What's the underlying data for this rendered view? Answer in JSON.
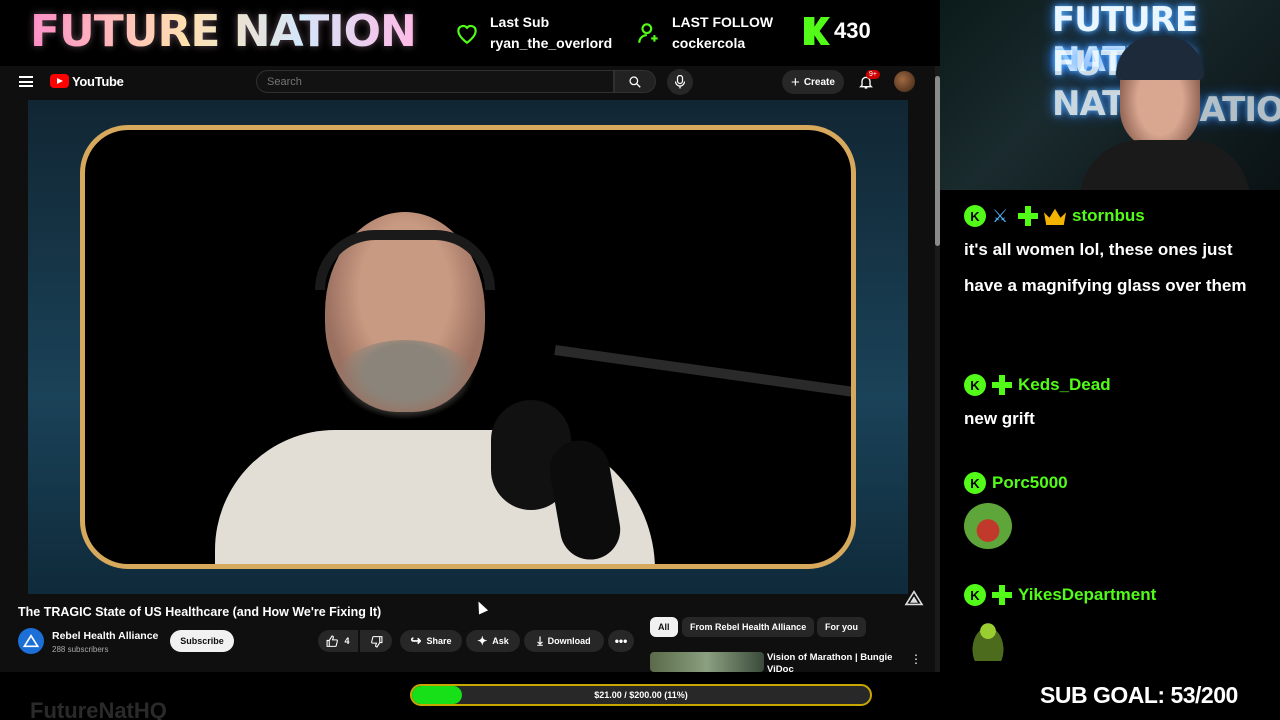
{
  "overlay": {
    "logo": "FUTURE NATION",
    "last_sub_label": "Last Sub",
    "last_sub_name": "ryan_the_overlord",
    "last_follow_label": "LAST FOLLOW",
    "last_follow_name": "cockercola",
    "kick_count": "430",
    "twitter_handle": "FutureNatHQ",
    "donation_goal_text": "$21.00 / $200.00 (11%)",
    "donation_goal_progress": 0.11,
    "sub_goal_text": "SUB GOAL: 53/200",
    "colors": {
      "kick_green": "#53fc18",
      "gold": "#d6a95c",
      "yt_red": "#ff0000"
    }
  },
  "youtube": {
    "brand": "YouTube",
    "search_placeholder": "Search",
    "create_label": "Create",
    "notifications_badge": "9+",
    "video_title": "The TRAGIC State of US Healthcare (and How We're Fixing It)",
    "channel_name": "Rebel Health Alliance",
    "channel_subs": "288 subscribers",
    "subscribe_label": "Subscribe",
    "like_count": "4",
    "share_label": "Share",
    "ask_label": "Ask",
    "download_label": "Download",
    "chips": [
      "All",
      "From Rebel Health Alliance",
      "For you"
    ],
    "recommended_title": "Vision of Marathon | Bungie ViDoc"
  },
  "webcam": {
    "sign_lines": [
      "FUTURE NATION",
      "FUTURE NATION",
      "NATION"
    ]
  },
  "chat": [
    {
      "user": "stornbus",
      "badges": [
        "kick-icon",
        "sword-icon",
        "sparkle-icon",
        "crown-icon"
      ],
      "text": "it's all women lol, these ones just have a magnifying glass over them"
    },
    {
      "user": "Keds_Dead",
      "badges": [
        "kick-icon",
        "sparkle-icon"
      ],
      "text": "new grift"
    },
    {
      "user": "Porc5000",
      "badges": [
        "kick-icon"
      ],
      "emote": "frog-emote"
    },
    {
      "user": "YikesDepartment",
      "badges": [
        "kick-icon",
        "sparkle-icon"
      ],
      "emote": "turtle-emote"
    }
  ]
}
